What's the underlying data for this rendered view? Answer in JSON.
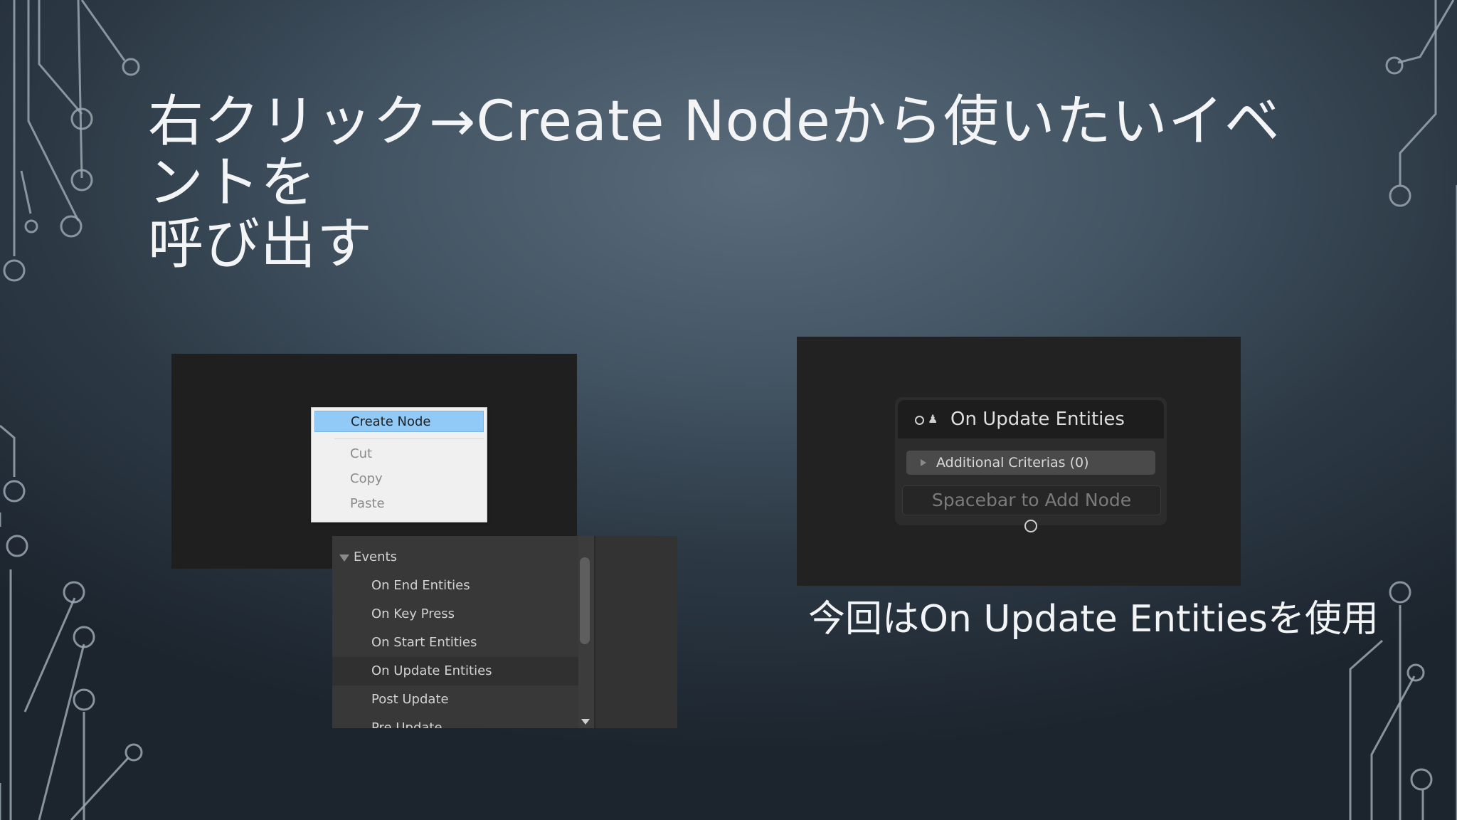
{
  "slide": {
    "title_line1": "右クリック→Create Nodeから使いたいイベントを",
    "title_line2": "呼び出す",
    "caption": "今回はOn Update Entitiesを使用"
  },
  "context_menu": {
    "items": [
      {
        "label": "Create Node",
        "state": "highlighted"
      },
      {
        "label": "Cut",
        "state": "disabled"
      },
      {
        "label": "Copy",
        "state": "disabled"
      },
      {
        "label": "Paste",
        "state": "disabled"
      }
    ]
  },
  "node_search": {
    "category": "Events",
    "items": [
      {
        "label": "On End Entities"
      },
      {
        "label": "On Key Press"
      },
      {
        "label": "On Start Entities"
      },
      {
        "label": "On Update Entities",
        "selected": true
      },
      {
        "label": "Post Update"
      },
      {
        "label": "Pre Update"
      }
    ]
  },
  "event_node": {
    "title": "On Update Entities",
    "criteria": "Additional Criterias (0)",
    "hint": "Spacebar to Add Node"
  },
  "colors": {
    "menu_highlight": "#91c9f7",
    "slide_text": "#f2f4f6"
  }
}
